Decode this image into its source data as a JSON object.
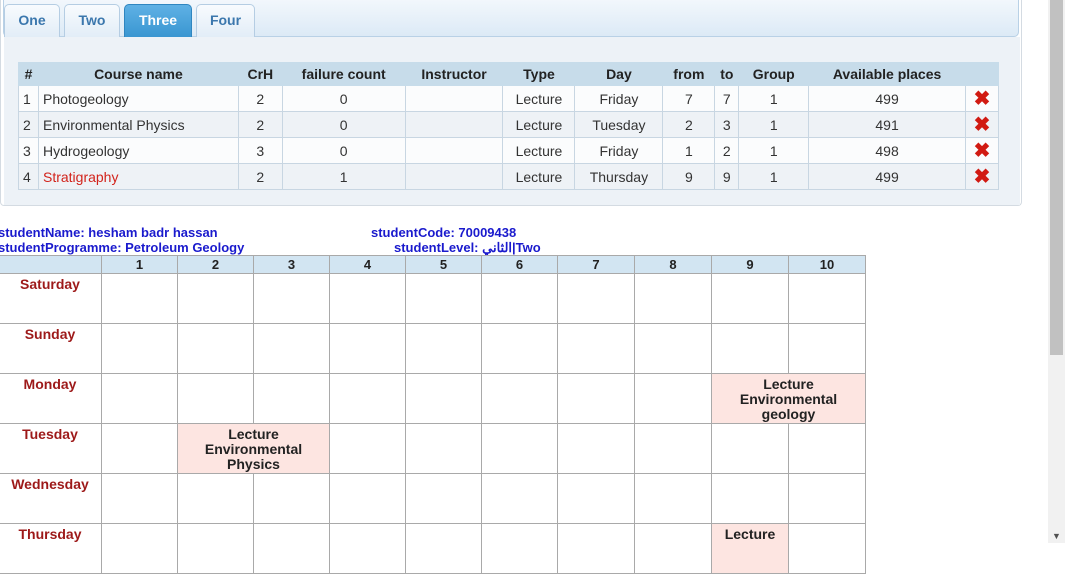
{
  "tabs": [
    {
      "label": "One",
      "active": false
    },
    {
      "label": "Two",
      "active": false
    },
    {
      "label": "Three",
      "active": true
    },
    {
      "label": "Four",
      "active": false
    }
  ],
  "courses_table": {
    "headers": [
      "#",
      "Course name",
      "CrH",
      "failure count",
      "Instructor",
      "Type",
      "Day",
      "from",
      "to",
      "Group",
      "Available places"
    ],
    "rows": [
      {
        "num": "1",
        "name": "Photogeology",
        "crh": "2",
        "failure": "0",
        "instructor": "",
        "type": "Lecture",
        "day": "Friday",
        "from": "7",
        "to": "7",
        "group": "1",
        "available": "499",
        "highlight": false
      },
      {
        "num": "2",
        "name": "Environmental Physics",
        "crh": "2",
        "failure": "0",
        "instructor": "",
        "type": "Lecture",
        "day": "Tuesday",
        "from": "2",
        "to": "3",
        "group": "1",
        "available": "491",
        "highlight": false
      },
      {
        "num": "3",
        "name": "Hydrogeology",
        "crh": "3",
        "failure": "0",
        "instructor": "",
        "type": "Lecture",
        "day": "Friday",
        "from": "1",
        "to": "2",
        "group": "1",
        "available": "498",
        "highlight": false
      },
      {
        "num": "4",
        "name": "Stratigraphy",
        "crh": "2",
        "failure": "1",
        "instructor": "",
        "type": "Lecture",
        "day": "Thursday",
        "from": "9",
        "to": "9",
        "group": "1",
        "available": "499",
        "highlight": true
      }
    ],
    "delete_icon": "close-x-icon",
    "highlight_color": "#d2231b"
  },
  "student": {
    "name_line": "studentName: hesham badr hassan",
    "programme_line": "studentProgramme: Petroleum Geology",
    "code_line": "studentCode: 70009438",
    "level_line": "studentLevel: الثاني|Two"
  },
  "schedule": {
    "periods": [
      "1",
      "2",
      "3",
      "4",
      "5",
      "6",
      "7",
      "8",
      "9",
      "10"
    ],
    "days": [
      "Saturday",
      "Sunday",
      "Monday",
      "Tuesday",
      "Wednesday",
      "Thursday"
    ],
    "monday_lecture": {
      "type": "Lecture",
      "course": "Environmental geology"
    },
    "tuesday_lecture": {
      "type": "Lecture",
      "course": "Environmental Physics"
    },
    "thursday_lecture": {
      "type": "Lecture",
      "course": ""
    }
  }
}
